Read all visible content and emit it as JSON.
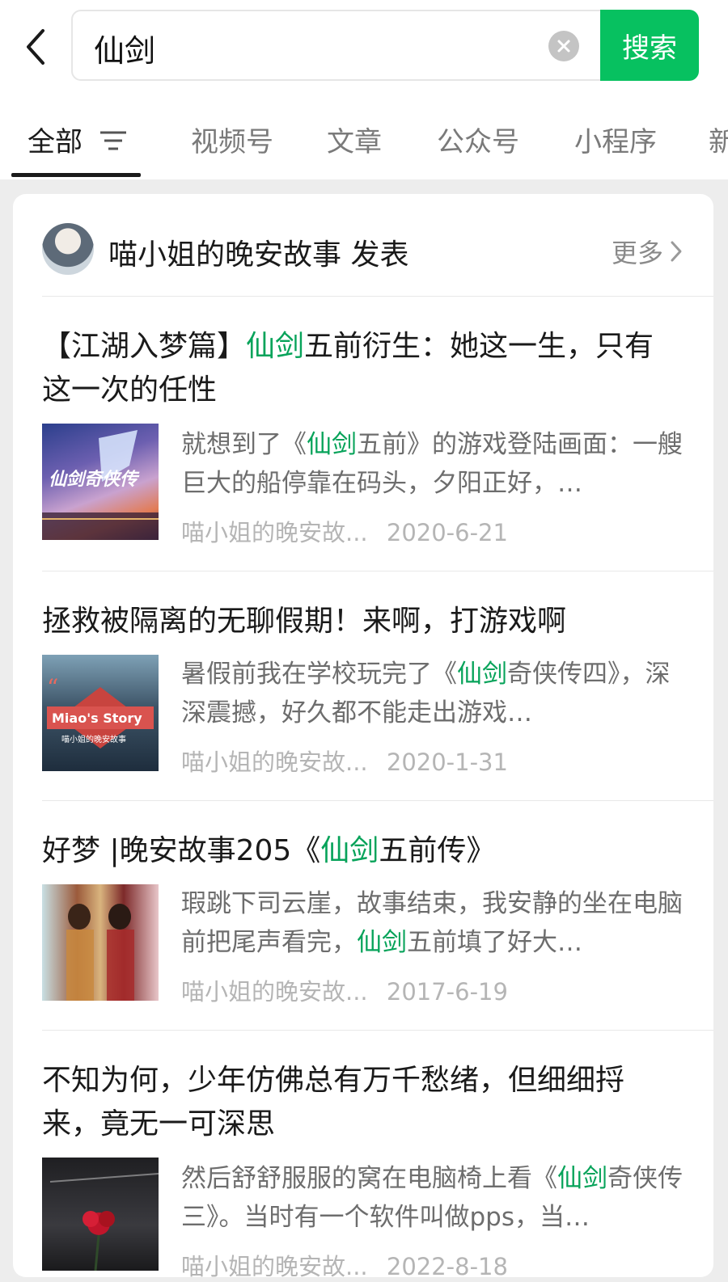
{
  "search": {
    "query": "仙剑",
    "button_label": "搜索"
  },
  "tabs": [
    {
      "label": "全部",
      "active": true
    },
    {
      "label": "视频号"
    },
    {
      "label": "文章"
    },
    {
      "label": "公众号"
    },
    {
      "label": "小程序"
    },
    {
      "label": "新"
    }
  ],
  "header": {
    "author": "喵小姐的晚安故事 发表",
    "more_label": "更多"
  },
  "colors": {
    "brand_green": "#07c160",
    "highlight": "#07a35a"
  },
  "articles": [
    {
      "title_pre": "【江湖入梦篇】",
      "title_hl": "仙剑",
      "title_post": "五前衍生：她这一生，只有这一次的任性",
      "snippet_pre": "就想到了《",
      "snippet_hl": "仙剑",
      "snippet_post": "五前》的游戏登陆画面：一艘巨大的船停靠在码头，夕阳正好，…",
      "source": "喵小姐的晚安故...",
      "date": "2020-6-21",
      "thumb_text": "仙剑奇侠传"
    },
    {
      "title_pre": "拯救被隔离的无聊假期！来啊，打游戏啊",
      "title_hl": "",
      "title_post": "",
      "snippet_pre": "暑假前我在学校玩完了《",
      "snippet_hl": "仙剑",
      "snippet_post": "奇侠传四》，深深震撼，好久都不能走出游戏…",
      "source": "喵小姐的晚安故...",
      "date": "2020-1-31",
      "thumb_text": "Miao's Story",
      "thumb_sub": "喵小姐的晚安故事"
    },
    {
      "title_pre": "好梦 |晚安故事205《",
      "title_hl": "仙剑",
      "title_post": "五前传》",
      "snippet_pre": "瑕跳下司云崖，故事结束，我安静的坐在电脑前把尾声看完，",
      "snippet_hl": "仙剑",
      "snippet_post": "五前填了好大…",
      "source": "喵小姐的晚安故...",
      "date": "2017-6-19"
    },
    {
      "title_pre": "不知为何，少年仿佛总有万千愁绪，但细细捋来，竟无一可深思",
      "title_hl": "",
      "title_post": "",
      "snippet_pre": "然后舒舒服服的窝在电脑椅上看《",
      "snippet_hl": "仙剑",
      "snippet_post": "奇侠传三》。当时有一个软件叫做pps，当…",
      "source": "喵小姐的晚安故...",
      "date": "2022-8-18"
    }
  ]
}
